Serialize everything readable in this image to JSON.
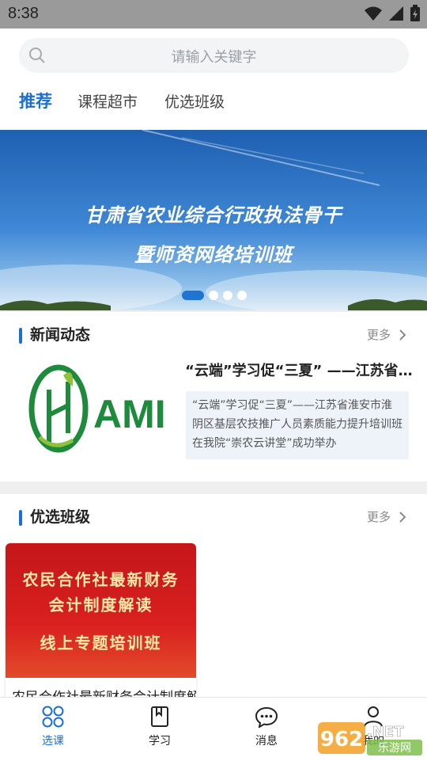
{
  "status_bar": {
    "time": "8:38"
  },
  "search": {
    "placeholder": "请输入关键字"
  },
  "tabs": [
    {
      "label": "推荐",
      "active": true
    },
    {
      "label": "课程超市",
      "active": false
    },
    {
      "label": "优选班级",
      "active": false
    }
  ],
  "banner": {
    "line1": "甘肃省农业综合行政执法骨干",
    "line2": "暨师资网络培训班",
    "slide_count": 4,
    "active_slide": 1
  },
  "news": {
    "section_title": "新闻动态",
    "more_label": "更多",
    "logo_text": "AMI",
    "headline": "“云端”学习促“三夏” ——江苏省淮安市淮阴区基层农技推广人员素质能力提升培训班在我院“崇农云讲堂”成功举办",
    "summary": "“云端”学习促“三夏”——江苏省淮安市淮阴区基层农技推广人员素质能力提升培训班在我院“崇农云讲堂”成功举办"
  },
  "classes": {
    "section_title": "优选班级",
    "more_label": "更多",
    "card": {
      "poster_line1": "农民合作社最新财务",
      "poster_line2": "会计制度解读",
      "poster_line3": "线上专题培训班",
      "title": "农民合作社最新财务会计制度解读线上专题培训班"
    }
  },
  "bottom_nav": [
    {
      "label": "选课",
      "icon": "grid-icon",
      "active": true
    },
    {
      "label": "学习",
      "icon": "book-icon",
      "active": false
    },
    {
      "label": "消息",
      "icon": "chat-icon",
      "active": false
    },
    {
      "label": "我的",
      "icon": "user-icon",
      "active": false
    }
  ],
  "watermark": {
    "text": "962",
    "subtext": ".NET",
    "caption": "乐游网"
  },
  "colors": {
    "accent": "#1a6fd1",
    "poster_red": "#d9201f",
    "logo_green": "#1e8a3c"
  }
}
